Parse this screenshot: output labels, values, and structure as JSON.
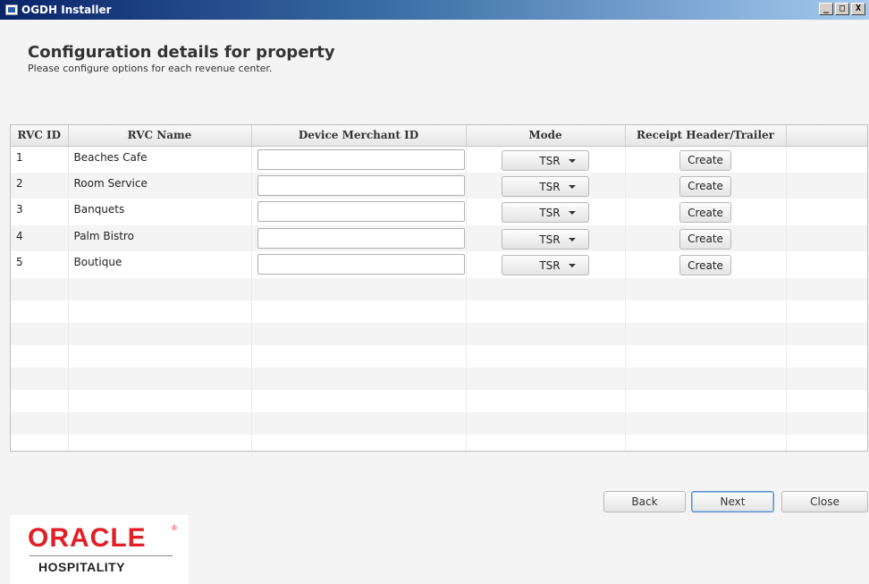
{
  "window": {
    "title": "OGDH Installer",
    "controls": [
      "_",
      "□",
      "X"
    ]
  },
  "header": {
    "title": "Configuration details for property",
    "subtitle": "Please configure options for each revenue center."
  },
  "table": {
    "columns": [
      "RVC ID",
      "RVC Name",
      "Device Merchant ID",
      "Mode",
      "Receipt Header/Trailer",
      ""
    ],
    "rows": [
      {
        "id": "1",
        "name": "Beaches Cafe",
        "merchant_id": "",
        "mode": "TSR",
        "action": "Create"
      },
      {
        "id": "2",
        "name": "Room Service",
        "merchant_id": "",
        "mode": "TSR",
        "action": "Create"
      },
      {
        "id": "3",
        "name": "Banquets",
        "merchant_id": "",
        "mode": "TSR",
        "action": "Create"
      },
      {
        "id": "4",
        "name": "Palm Bistro",
        "merchant_id": "",
        "mode": "TSR",
        "action": "Create"
      },
      {
        "id": "5",
        "name": "Boutique",
        "merchant_id": "",
        "mode": "TSR",
        "action": "Create"
      }
    ]
  },
  "footer": {
    "back_label": "Back",
    "next_label": "Next",
    "close_label": "Close"
  },
  "logo": {
    "brand": "ORACLE",
    "registered": "®",
    "subtitle": "HOSPITALITY",
    "brand_color": "#e21f26"
  }
}
